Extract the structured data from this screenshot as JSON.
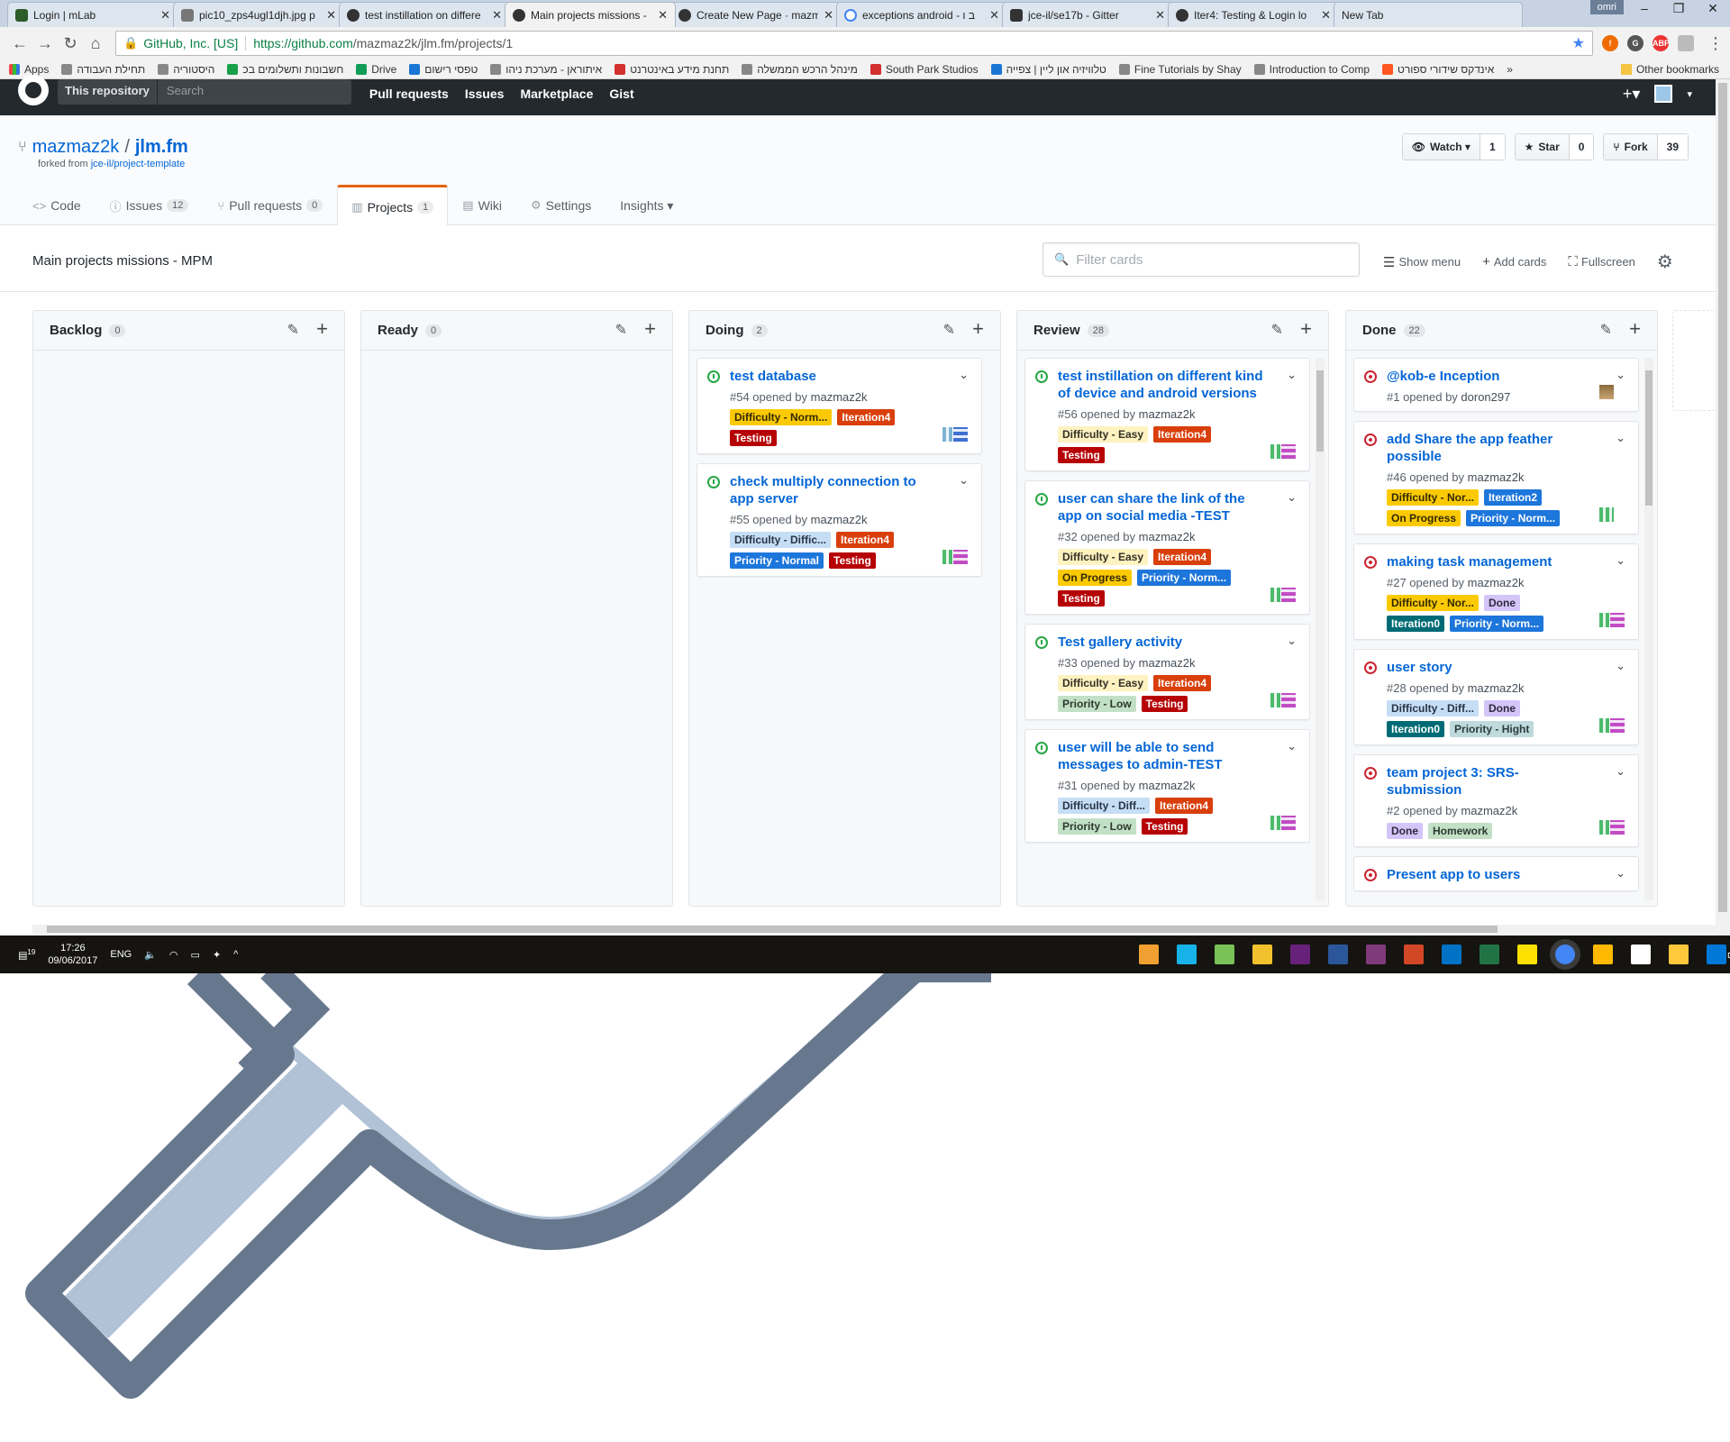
{
  "browser": {
    "tabs": [
      {
        "title": "Login | mLab",
        "icon": "mlab"
      },
      {
        "title": "pic10_zps4ugl1djh.jpg p",
        "icon": "img"
      },
      {
        "title": "test instillation on differe",
        "icon": "gh"
      },
      {
        "title": "Main projects missions -",
        "icon": "gh"
      },
      {
        "title": "Create New Page · mazm",
        "icon": "gh"
      },
      {
        "title": "exceptions android - ב ו",
        "icon": "g"
      },
      {
        "title": "jce-il/se17b - Gitter",
        "icon": "gitter"
      },
      {
        "title": "Iter4: Testing & Login lo",
        "icon": "gh"
      },
      {
        "title": "New Tab",
        "icon": "none"
      }
    ],
    "active_tab": 3,
    "user": "omri",
    "address": {
      "org": "GitHub, Inc. [US]",
      "url_host": "https://github.com",
      "url_path": "/mazmaz2k/jlm.fm/projects/1"
    },
    "bookmarks": [
      {
        "label": "Apps",
        "icon": "apps"
      },
      {
        "label": "תחילת העבודה",
        "icon": "chrome"
      },
      {
        "label": "היסטוריה",
        "icon": "history"
      },
      {
        "label": "חשבונות ותשלומים בכ",
        "icon": "green"
      },
      {
        "label": "Drive",
        "icon": "drive"
      },
      {
        "label": "טפסי רישום",
        "icon": "blue"
      },
      {
        "label": "איתוראן - מערכת ניהו",
        "icon": "gray"
      },
      {
        "label": "תחנת מידע באינטרנט",
        "icon": "red"
      },
      {
        "label": "מינהל הרכש הממשלה",
        "icon": "gray"
      },
      {
        "label": "South Park Studios",
        "icon": "red"
      },
      {
        "label": "טלוויזיה און ליין | צפייה",
        "icon": "blue"
      },
      {
        "label": "Fine Tutorials by Shay",
        "icon": "gray"
      },
      {
        "label": "Introduction to Comp",
        "icon": "gray"
      },
      {
        "label": "אינדקס שידורי ספורט",
        "icon": "orange"
      }
    ],
    "bookmarks_more": "»",
    "other_bookmarks": "Other bookmarks"
  },
  "github": {
    "scope_label": "This repository",
    "search_placeholder": "Search",
    "nav": [
      "Pull requests",
      "Issues",
      "Marketplace",
      "Gist"
    ],
    "plus": "+▾"
  },
  "repo": {
    "owner": "mazmaz2k",
    "name": "jlm.fm",
    "forked_prefix": "forked from",
    "forked_from": "jce-il/project-template",
    "watch": {
      "label": "Watch ▾",
      "count": "1"
    },
    "star": {
      "label": "Star",
      "count": "0"
    },
    "fork": {
      "label": "Fork",
      "count": "39"
    },
    "tabs": [
      {
        "label": "Code",
        "count": null,
        "icon": "<>"
      },
      {
        "label": "Issues",
        "count": "12",
        "icon": "ⓘ"
      },
      {
        "label": "Pull requests",
        "count": "0",
        "icon": "⑂"
      },
      {
        "label": "Projects",
        "count": "1",
        "icon": "▥"
      },
      {
        "label": "Wiki",
        "count": null,
        "icon": "▤"
      },
      {
        "label": "Settings",
        "count": null,
        "icon": "⚙"
      },
      {
        "label": "Insights ▾",
        "count": null,
        "icon": ""
      }
    ],
    "selected_tab": 3
  },
  "project": {
    "name": "Main projects missions - MPM",
    "filter_placeholder": "Filter cards",
    "actions": {
      "show_menu": "Show menu",
      "add_cards": "Add cards",
      "fullscreen": "Fullscreen"
    }
  },
  "label_colors": {
    "Difficulty - Normal": {
      "bg": "#fbca04",
      "fg": "#332900"
    },
    "Difficulty - Easy": {
      "bg": "#fef2c0",
      "fg": "#333026"
    },
    "Difficulty - Difficult": {
      "bg": "#c5def5",
      "fg": "#273445"
    },
    "Iteration4": {
      "bg": "#d93f0b",
      "fg": "#ffffff"
    },
    "Iteration2": {
      "bg": "#1d76db",
      "fg": "#ffffff"
    },
    "Iteration0": {
      "bg": "#006b75",
      "fg": "#ffffff"
    },
    "Testing": {
      "bg": "#b60205",
      "fg": "#ffffff"
    },
    "Priority - Normal": {
      "bg": "#1d76db",
      "fg": "#ffffff"
    },
    "Priority - Low": {
      "bg": "#c2e0c6",
      "fg": "#2c3a2d"
    },
    "Priority - Hight": {
      "bg": "#bfdadc",
      "fg": "#2b3b3c"
    },
    "On Progress": {
      "bg": "#fbca04",
      "fg": "#332900"
    },
    "Done": {
      "bg": "#d4c5f9",
      "fg": "#2f2a3d"
    },
    "Homework": {
      "bg": "#c2e0c6",
      "fg": "#2c3a2d"
    }
  },
  "columns": [
    {
      "name": "Backlog",
      "count": "0",
      "cards": []
    },
    {
      "name": "Ready",
      "count": "0",
      "cards": []
    },
    {
      "name": "Doing",
      "count": "2",
      "cards": [
        {
          "title": "test database",
          "number": "#54",
          "opened_by": "mazmaz2k",
          "state": "open",
          "labels": [
            [
              "Difficulty - Norm...",
              "Difficulty - Normal"
            ],
            [
              "Iteration4",
              "Iteration4"
            ],
            [
              "Testing",
              "Testing"
            ]
          ],
          "avatar": "blue"
        },
        {
          "title": "check multiply connection to app server",
          "number": "#55",
          "opened_by": "mazmaz2k",
          "state": "open",
          "labels": [
            [
              "Difficulty - Diffic...",
              "Difficulty - Difficult"
            ],
            [
              "Iteration4",
              "Iteration4"
            ],
            [
              "Priority - Normal",
              "Priority - Normal"
            ],
            [
              "Testing",
              "Testing"
            ]
          ],
          "avatar": "double"
        }
      ]
    },
    {
      "name": "Review",
      "count": "28",
      "cards": [
        {
          "title": "test instillation on different kind of device and android versions",
          "number": "#56",
          "opened_by": "mazmaz2k",
          "state": "open",
          "labels": [
            [
              "Difficulty - Easy",
              "Difficulty - Easy"
            ],
            [
              "Iteration4",
              "Iteration4"
            ],
            [
              "Testing",
              "Testing"
            ]
          ],
          "avatar": "double"
        },
        {
          "title": "user can share the link of the app on social media -TEST",
          "number": "#32",
          "opened_by": "mazmaz2k",
          "state": "open",
          "labels": [
            [
              "Difficulty - Easy",
              "Difficulty - Easy"
            ],
            [
              "Iteration4",
              "Iteration4"
            ],
            [
              "On Progress",
              "On Progress"
            ],
            [
              "Priority - Norm...",
              "Priority - Normal"
            ],
            [
              "Testing",
              "Testing"
            ]
          ],
          "avatar": "double"
        },
        {
          "title": "Test gallery activity",
          "number": "#33",
          "opened_by": "mazmaz2k",
          "state": "open",
          "labels": [
            [
              "Difficulty - Easy",
              "Difficulty - Easy"
            ],
            [
              "Iteration4",
              "Iteration4"
            ],
            [
              "Priority - Low",
              "Priority - Low"
            ],
            [
              "Testing",
              "Testing"
            ]
          ],
          "avatar": "double"
        },
        {
          "title": "user will be able to send messages to admin-TEST",
          "number": "#31",
          "opened_by": "mazmaz2k",
          "state": "open",
          "labels": [
            [
              "Difficulty - Diff...",
              "Difficulty - Difficult"
            ],
            [
              "Iteration4",
              "Iteration4"
            ],
            [
              "Priority - Low",
              "Priority - Low"
            ],
            [
              "Testing",
              "Testing"
            ]
          ],
          "avatar": "double"
        }
      ]
    },
    {
      "name": "Done",
      "count": "22",
      "cards": [
        {
          "title": "@kob-e Inception",
          "number": "#1",
          "opened_by": "doron297",
          "state": "closed",
          "labels": [],
          "avatar": "photo"
        },
        {
          "title": "add Share the app feather possible",
          "number": "#46",
          "opened_by": "mazmaz2k",
          "state": "closed",
          "labels": [
            [
              "Difficulty - Nor...",
              "Difficulty - Normal"
            ],
            [
              "Iteration2",
              "Iteration2"
            ],
            [
              "On Progress",
              "On Progress"
            ],
            [
              "Priority - Norm...",
              "Priority - Normal"
            ]
          ],
          "avatar": "single"
        },
        {
          "title": "making task management",
          "number": "#27",
          "opened_by": "mazmaz2k",
          "state": "closed",
          "labels": [
            [
              "Difficulty - Nor...",
              "Difficulty - Normal"
            ],
            [
              "Done",
              "Done"
            ],
            [
              "Iteration0",
              "Iteration0"
            ],
            [
              "Priority - Norm...",
              "Priority - Normal"
            ]
          ],
          "avatar": "double"
        },
        {
          "title": "user story",
          "number": "#28",
          "opened_by": "mazmaz2k",
          "state": "closed",
          "labels": [
            [
              "Difficulty - Diff...",
              "Difficulty - Difficult"
            ],
            [
              "Done",
              "Done"
            ],
            [
              "Iteration0",
              "Iteration0"
            ],
            [
              "Priority - Hight",
              "Priority - Hight"
            ]
          ],
          "avatar": "double"
        },
        {
          "title": "team project 3: SRS-submission",
          "number": "#2",
          "opened_by": "mazmaz2k",
          "state": "closed",
          "labels": [
            [
              "Done",
              "Done"
            ],
            [
              "Homework",
              "Homework"
            ]
          ],
          "avatar": "double"
        },
        {
          "title": "Present app to users",
          "number": "",
          "opened_by": "",
          "state": "closed",
          "labels": [],
          "avatar": "none"
        }
      ]
    }
  ],
  "opened_by_text": "opened by",
  "taskbar": {
    "notif_count": "19",
    "time": "17:26",
    "date": "09/06/2017",
    "lang": "ENG",
    "apps": [
      {
        "name": "paint-icon",
        "color": "#f0a030"
      },
      {
        "name": "kodi-icon",
        "color": "#17b2e7"
      },
      {
        "name": "android-studio-icon",
        "color": "#78c257"
      },
      {
        "name": "sourcetree-icon",
        "color": "#f2c12e"
      },
      {
        "name": "visual-studio-icon",
        "color": "#68217a"
      },
      {
        "name": "word-icon",
        "color": "#2b579a"
      },
      {
        "name": "onenote-icon",
        "color": "#80397b"
      },
      {
        "name": "powerpoint-icon",
        "color": "#d24726"
      },
      {
        "name": "outlook-icon",
        "color": "#0072c6"
      },
      {
        "name": "excel-icon",
        "color": "#217346"
      },
      {
        "name": "sticky-notes-icon",
        "color": "#fce100"
      },
      {
        "name": "chrome-icon",
        "color": "#4285f4"
      },
      {
        "name": "file-icon",
        "color": "#ffb900"
      },
      {
        "name": "store-icon",
        "color": "#ffffff"
      },
      {
        "name": "explorer-icon",
        "color": "#ffc83d"
      },
      {
        "name": "edge-icon",
        "color": "#0078d7"
      }
    ]
  }
}
